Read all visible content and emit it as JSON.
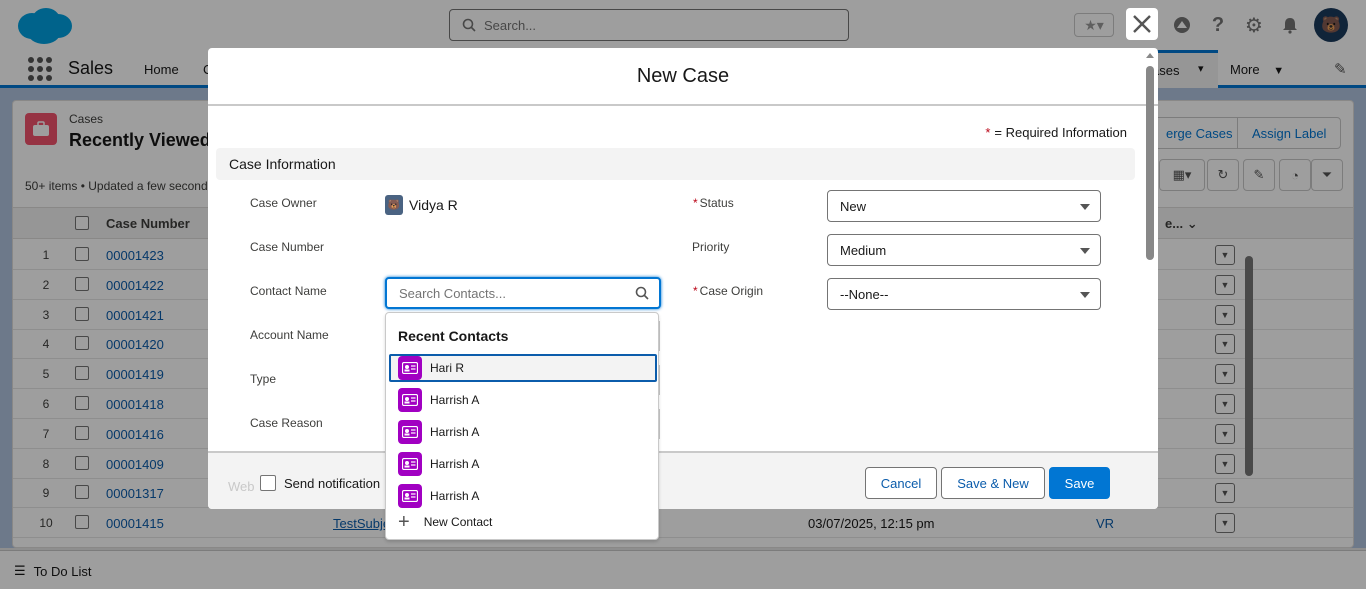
{
  "topbar": {
    "search_placeholder": "Search...",
    "colors": {
      "brand": "#00a1e0",
      "accent": "#0176d3"
    }
  },
  "nav": {
    "app_name": "Sales",
    "home": "Home",
    "partial_tab": "C",
    "cases_tab": "ases",
    "more": "More"
  },
  "list": {
    "object_label": "Cases",
    "title": "Recently Viewed",
    "meta": "50+ items • Updated a few second",
    "merge_button": "erge Cases",
    "assign_button": "Assign Label",
    "column_case_number": "Case Number",
    "column_partial": "e...",
    "rows": [
      {
        "num": "1",
        "case": "00001423"
      },
      {
        "num": "2",
        "case": "00001422"
      },
      {
        "num": "3",
        "case": "00001421"
      },
      {
        "num": "4",
        "case": "00001420"
      },
      {
        "num": "5",
        "case": "00001419"
      },
      {
        "num": "6",
        "case": "00001418"
      },
      {
        "num": "7",
        "case": "00001416"
      },
      {
        "num": "8",
        "case": "00001409"
      },
      {
        "num": "9",
        "case": "00001317"
      },
      {
        "num": "10",
        "case": "00001415",
        "subject": "TestSubje",
        "date": "03/07/2025, 12:15 pm",
        "owner": "VR"
      }
    ]
  },
  "footer": {
    "todo": "To Do List"
  },
  "modal": {
    "title": "New Case",
    "required_info": "= Required Information",
    "section": "Case Information",
    "fields": {
      "case_owner_label": "Case Owner",
      "case_owner_value": "Vidya R",
      "case_number_label": "Case Number",
      "contact_name_label": "Contact Name",
      "contact_placeholder": "Search Contacts...",
      "account_name_label": "Account Name",
      "type_label": "Type",
      "case_reason_label": "Case Reason",
      "status_label": "Status",
      "status_value": "New",
      "priority_label": "Priority",
      "priority_value": "Medium",
      "case_origin_label": "Case Origin",
      "case_origin_value": "--None--"
    },
    "footer": {
      "web_ghost": "Web",
      "send_notification": "Send notification",
      "cancel": "Cancel",
      "save_new": "Save & New",
      "save": "Save"
    }
  },
  "dropdown": {
    "heading": "Recent Contacts",
    "items": [
      {
        "name": "Hari R"
      },
      {
        "name": "Harrish A"
      },
      {
        "name": "Harrish A"
      },
      {
        "name": "Harrish A"
      },
      {
        "name": "Harrish A"
      }
    ],
    "new_contact": "New Contact",
    "icon_color": "#a100c2"
  }
}
